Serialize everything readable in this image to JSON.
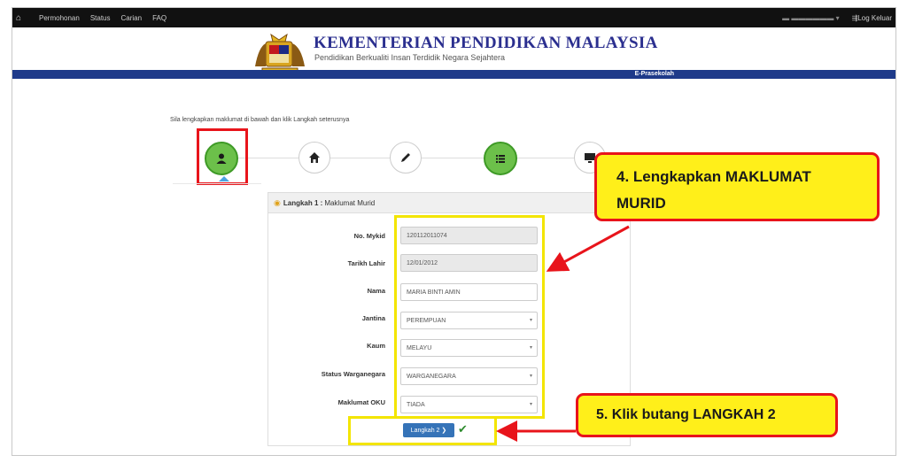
{
  "topnav": {
    "items": [
      "Permohonan",
      "Status",
      "Carian",
      "FAQ"
    ],
    "logout": "Log Keluar"
  },
  "header": {
    "title": "KEMENTERIAN PENDIDIKAN MALAYSIA",
    "subtitle": "Pendidikan Berkualiti Insan Terdidik Negara Sejahtera",
    "system_name": "E-Prasekolah"
  },
  "instructions": "Sila lengkapkan maklumat di bawah dan klik Langkah seterusnya",
  "panel": {
    "step_label": "Langkah 1 :",
    "step_title": "Maklumat Murid"
  },
  "form": {
    "mykid_label": "No. Mykid",
    "mykid_value": "120112011074",
    "dob_label": "Tarikh Lahir",
    "dob_value": "12/01/2012",
    "name_label": "Nama",
    "name_value": "MARIA BINTI AMIN",
    "gender_label": "Jantina",
    "gender_value": "PEREMPUAN",
    "race_label": "Kaum",
    "race_value": "MELAYU",
    "citizenship_label": "Status Warganegara",
    "citizenship_value": "WARGANEGARA",
    "oku_label": "Maklumat OKU",
    "oku_value": "TIADA"
  },
  "next_button": "Langkah 2",
  "callouts": {
    "c4_line1": "4. Lengkapkan MAKLUMAT",
    "c4_line2": "MURID",
    "c5": "5. Klik butang LANGKAH 2"
  },
  "colors": {
    "accent_blue": "#3573b8",
    "banner_blue": "#1e3a8a",
    "step_green": "#6cc04a",
    "highlight_red": "#e8141b",
    "highlight_yellow": "#f3e500"
  },
  "icons": [
    "home-icon",
    "user-icon",
    "pencil-icon",
    "list-icon",
    "monitor-icon",
    "logout-icon",
    "chevron-right-icon",
    "check-icon"
  ]
}
